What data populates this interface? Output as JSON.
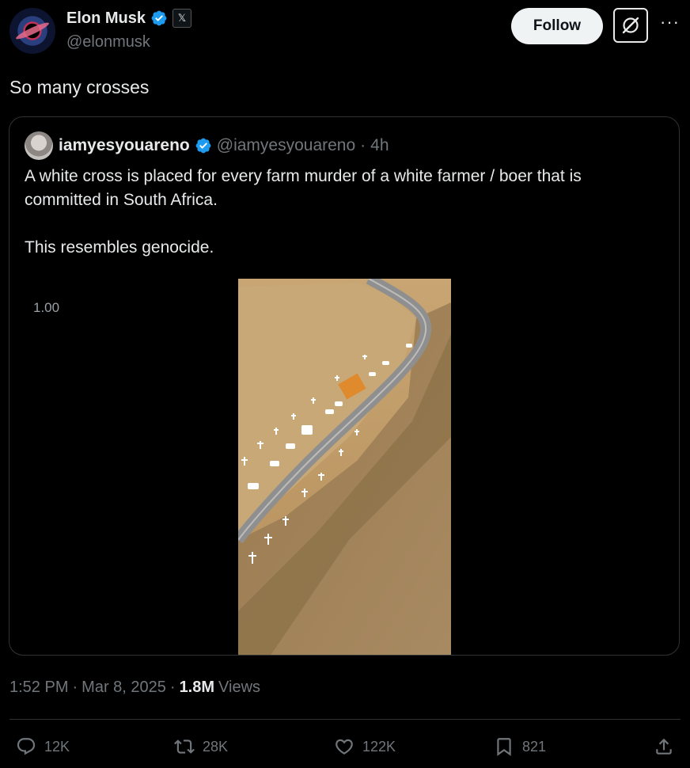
{
  "author": {
    "name": "Elon Musk",
    "handle": "@elonmusk",
    "x_badge": "𝕏"
  },
  "header": {
    "follow_label": "Follow",
    "more_label": "···"
  },
  "tweet": {
    "text": "So many crosses"
  },
  "quote": {
    "name": "iamyesyouareno",
    "handle": "@iamyesyouareno",
    "separator": "·",
    "time": "4h",
    "paragraph1": "A white cross is placed for every farm murder of a white farmer / boer that is committed in South Africa.",
    "paragraph2": "This resembles genocide.",
    "media_overlay": "1.00"
  },
  "meta": {
    "time": "1:52 PM",
    "sep1": "·",
    "date": "Mar 8, 2025",
    "sep2": "·",
    "views_count": "1.8M",
    "views_label": "Views"
  },
  "actions": {
    "replies": "12K",
    "reposts": "28K",
    "likes": "122K",
    "bookmarks": "821"
  },
  "colors": {
    "background": "#000000",
    "text": "#e7e9ea",
    "muted": "#71767b",
    "verified": "#1d9bf0",
    "border": "#2f3336"
  }
}
